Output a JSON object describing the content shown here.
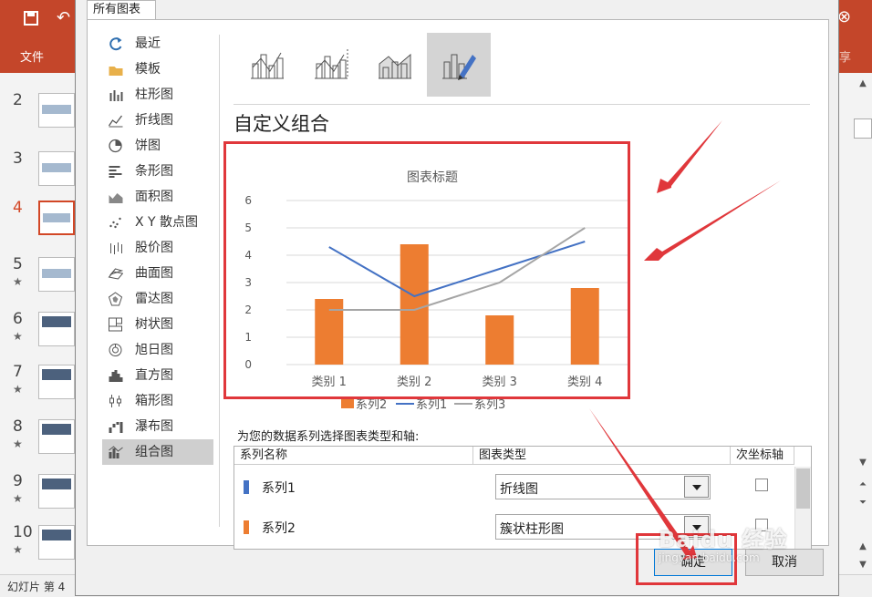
{
  "ribbon": {
    "file_label": "文件"
  },
  "slides": [
    {
      "num": "2",
      "star": ""
    },
    {
      "num": "3",
      "star": ""
    },
    {
      "num": "4",
      "star": ""
    },
    {
      "num": "5",
      "star": "★"
    },
    {
      "num": "6",
      "star": "★"
    },
    {
      "num": "7",
      "star": "★"
    },
    {
      "num": "8",
      "star": "★"
    },
    {
      "num": "9",
      "star": "★"
    },
    {
      "num": "10",
      "star": "★"
    }
  ],
  "statusbar": {
    "text": "幻灯片 第 4"
  },
  "dialog": {
    "tab_label": "所有图表",
    "chart_types": [
      "最近",
      "模板",
      "柱形图",
      "折线图",
      "饼图",
      "条形图",
      "面积图",
      "X Y 散点图",
      "股价图",
      "曲面图",
      "雷达图",
      "树状图",
      "旭日图",
      "直方图",
      "箱形图",
      "瀑布图",
      "组合图"
    ],
    "selected_type": "组合图",
    "subtype_title": "自定义组合",
    "series_heading": "为您的数据系列选择图表类型和轴:",
    "table_headers": {
      "name": "系列名称",
      "type": "图表类型",
      "secondary": "次坐标轴"
    },
    "series_rows": [
      {
        "name": "系列1",
        "type": "折线图",
        "color": "#4472c4",
        "secondary_checked": false
      },
      {
        "name": "系列2",
        "type": "簇状柱形图",
        "color": "#ed7d31",
        "secondary_checked": false
      }
    ],
    "ok_label": "确定",
    "cancel_label": "取消"
  },
  "watermark": {
    "text": "Baidu 经验",
    "url": "jingyan.baidu.com"
  },
  "chart_data": {
    "type": "bar",
    "title": "图表标题",
    "categories": [
      "类别 1",
      "类别 2",
      "类别 3",
      "类别 4"
    ],
    "ylim": [
      0,
      6
    ],
    "yticks": [
      0,
      1,
      2,
      3,
      4,
      5,
      6
    ],
    "grid": true,
    "legend_position": "bottom",
    "series": [
      {
        "name": "系列2",
        "kind": "bar",
        "color": "#ed7d31",
        "values": [
          2.4,
          4.4,
          1.8,
          2.8
        ]
      },
      {
        "name": "系列1",
        "kind": "line",
        "color": "#4472c4",
        "values": [
          4.3,
          2.5,
          3.5,
          4.5
        ]
      },
      {
        "name": "系列3",
        "kind": "line",
        "color": "#a5a5a5",
        "values": [
          2,
          2,
          3,
          5
        ]
      }
    ]
  }
}
